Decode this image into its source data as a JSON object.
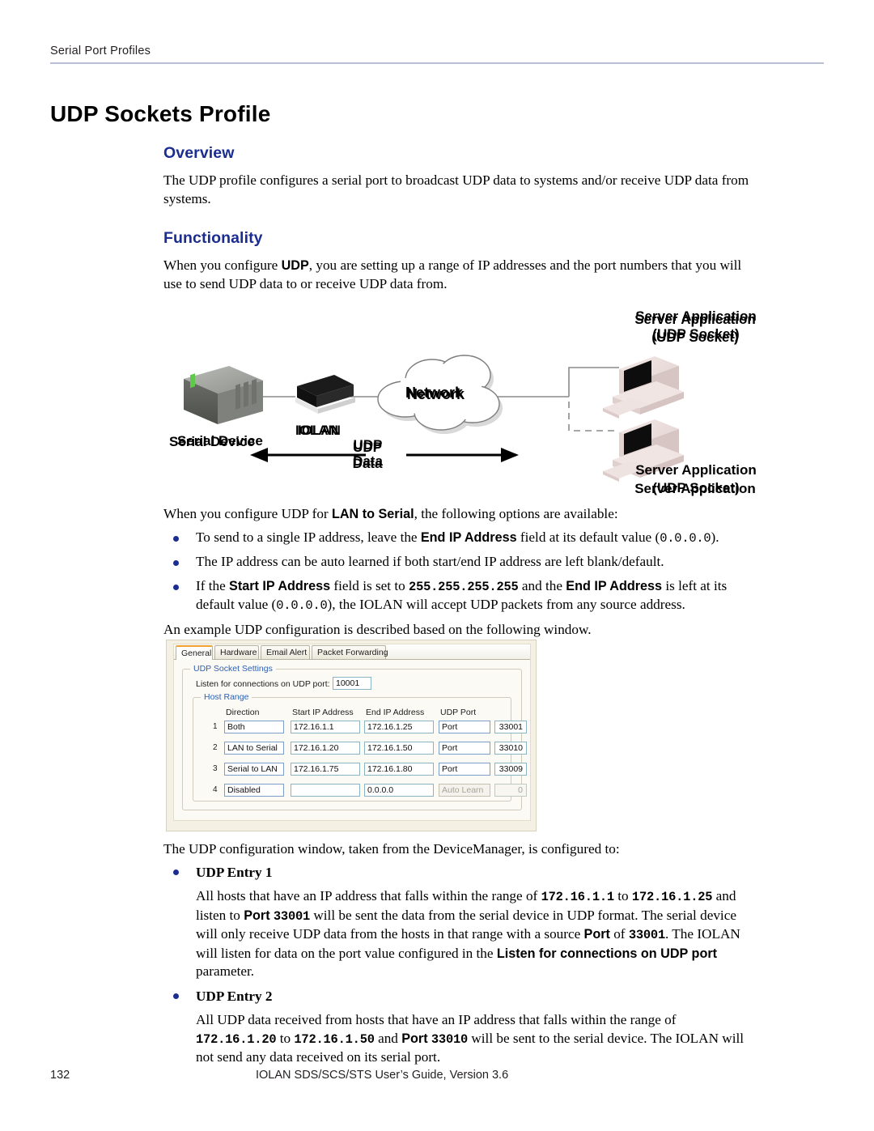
{
  "header": {
    "running_head": "Serial Port Profiles"
  },
  "chapter": {
    "title": "UDP Sockets Profile"
  },
  "overview": {
    "heading": "Overview",
    "paragraph": "The UDP profile configures a serial port to broadcast UDP data to systems and/or receive UDP data from systems."
  },
  "functionality": {
    "heading": "Functionality",
    "intro_a": "When you configure ",
    "intro_udp": "UDP",
    "intro_b": ", you are setting up a range of IP addresses and the port numbers that you will use to send UDP data to or receive UDP data from.",
    "lan_to_serial_line_a": "When you configure UDP for ",
    "lan_to_serial_bold": "LAN to Serial",
    "lan_to_serial_line_b": ", the following options are available:",
    "bullets": [
      {
        "a": "To send to a single IP address, leave the ",
        "bold1": "End IP Address",
        "b": " field at its default value (",
        "code1": "0.0.0.0",
        "c": ")."
      },
      {
        "a": "The IP address can be auto learned if both start/end IP address are left blank/default."
      },
      {
        "a": "If the ",
        "bold1": "Start IP Address",
        "b": " field is set to ",
        "code1": "255.255.255.255",
        "c": " and the ",
        "bold2": "End IP Address",
        "d": " is left at its default value (",
        "code2": "0.0.0.0",
        "e": "), the IOLAN will accept UDP packets from any source address."
      }
    ],
    "example_line": "An example UDP configuration is described based on the following window."
  },
  "diagram": {
    "serial_device_label": "Serial Device",
    "iolan_label": "IOLAN",
    "network_label": "Network",
    "udp_label_line1": "UDP",
    "udp_label_line2": "Data",
    "server_top_line1": "Server Application",
    "server_top_line2": "(UDP Socket)",
    "server_bottom_line1": "Server Application",
    "server_bottom_line2": "(UDP Socket)"
  },
  "device_manager": {
    "tabs": [
      {
        "label": "General",
        "active": true
      },
      {
        "label": "Hardware",
        "active": false
      },
      {
        "label": "Email Alert",
        "active": false
      },
      {
        "label": "Packet Forwarding",
        "active": false
      }
    ],
    "group_udp_socket_settings": "UDP Socket Settings",
    "listen_label": "Listen for connections on UDP port:",
    "listen_value": "10001",
    "group_host_range": "Host Range",
    "columns": [
      "Direction",
      "Start IP Address",
      "End IP Address",
      "UDP Port"
    ],
    "rows": [
      {
        "num": "1",
        "direction": "Both",
        "start_ip": "172.16.1.1",
        "end_ip": "172.16.1.25",
        "port_mode": "Port",
        "port": "33001",
        "disabled": false
      },
      {
        "num": "2",
        "direction": "LAN to Serial",
        "start_ip": "172.16.1.20",
        "end_ip": "172.16.1.50",
        "port_mode": "Port",
        "port": "33010",
        "disabled": false
      },
      {
        "num": "3",
        "direction": "Serial to LAN",
        "start_ip": "172.16.1.75",
        "end_ip": "172.16.1.80",
        "port_mode": "Port",
        "port": "33009",
        "disabled": false
      },
      {
        "num": "4",
        "direction": "Disabled",
        "start_ip": "",
        "end_ip": "0.0.0.0",
        "port_mode": "Auto Learn",
        "port": "0",
        "disabled": true
      }
    ]
  },
  "config_description": {
    "lead": "The UDP configuration window, taken from the DeviceManager, is configured to:",
    "entry1": {
      "title": "UDP Entry 1",
      "a": "All hosts that have an IP address that falls within the range of ",
      "code1": "172.16.1.1",
      "b": " to ",
      "code2": "172.16.1.25",
      "c": " and listen to ",
      "bold1": "Port",
      "code3": "33001",
      "d": " will be sent the data from the serial device in UDP format. The serial device will only receive UDP data from the hosts in that range with a source ",
      "bold2": "Port",
      "e": " of ",
      "code4": "33001",
      "f": ". The IOLAN will listen for data on the port value configured in the ",
      "bold3": "Listen for connections on UDP port",
      "g": " parameter."
    },
    "entry2": {
      "title": "UDP Entry 2",
      "a": "All UDP data received from hosts that have an IP address that falls within the range of ",
      "code1": "172.16.1.20",
      "b": " to ",
      "code2": "172.16.1.50",
      "c": " and ",
      "bold1": "Port",
      "code3": "33010",
      "d": " will be sent to the serial device. The IOLAN will not send any data received on its serial port."
    }
  },
  "footer": {
    "page_number": "132",
    "text": "IOLAN SDS/SCS/STS User’s Guide, Version 3.6"
  },
  "colors": {
    "heading_blue": "#1b2d8f",
    "rule_gray": "#b9bfd4",
    "tab_active_orange": "#f0a22e",
    "group_label_blue": "#2f61b4"
  }
}
